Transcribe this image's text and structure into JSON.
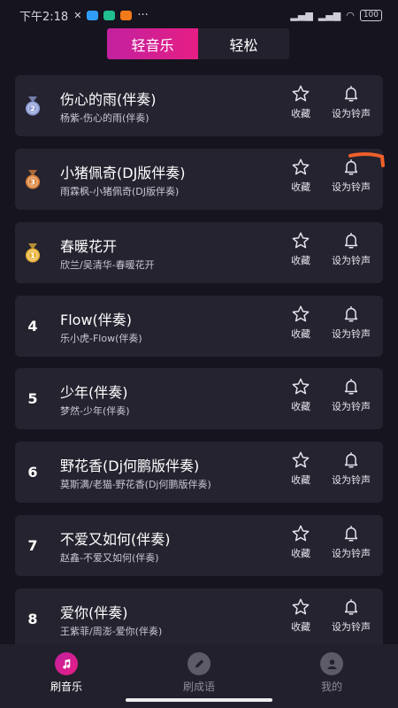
{
  "status_bar": {
    "time": "下午2:18",
    "battery": "100"
  },
  "tabs": [
    {
      "label": "轻音乐",
      "active": true
    },
    {
      "label": "轻松",
      "active": false
    }
  ],
  "songs": [
    {
      "rank": "2",
      "medal": "silver",
      "title": "伤心的雨(伴奏)",
      "artist": "杨紫-伤心的雨(伴奏)"
    },
    {
      "rank": "3",
      "medal": "bronze",
      "title": "小猪佩奇(DJ版伴奏)",
      "artist": "雨霖枫-小猪佩奇(DJ版伴奏)"
    },
    {
      "rank": "1",
      "medal": "gold",
      "title": "春暖花开",
      "artist": "欣兰/吴清华-春暖花开"
    },
    {
      "rank": "4",
      "medal": "",
      "title": "Flow(伴奏)",
      "artist": "乐小虎-Flow(伴奏)"
    },
    {
      "rank": "5",
      "medal": "",
      "title": "少年(伴奏)",
      "artist": "梦然-少年(伴奏)"
    },
    {
      "rank": "6",
      "medal": "",
      "title": "野花香(Dj何鹏版伴奏)",
      "artist": "莫斯满/老猫-野花香(Dj何鹏版伴奏)"
    },
    {
      "rank": "7",
      "medal": "",
      "title": "不爱又如何(伴奏)",
      "artist": "赵鑫-不爱又如何(伴奏)"
    },
    {
      "rank": "8",
      "medal": "",
      "title": "爱你(伴奏)",
      "artist": "王紫菲/周澎-爱你(伴奏)"
    }
  ],
  "actions": {
    "favorite_label": "收藏",
    "ringtone_label": "设为铃声"
  },
  "bottom_nav": [
    {
      "label": "刷音乐",
      "icon": "music-note-icon",
      "active": true
    },
    {
      "label": "刷成语",
      "icon": "pencil-icon",
      "active": false
    },
    {
      "label": "我的",
      "icon": "person-icon",
      "active": false
    }
  ],
  "colors": {
    "accent": "#e61e85",
    "background": "#16141f",
    "card": "#25232f",
    "medal_gold": "#e8b339",
    "medal_silver": "#8e9dd6",
    "medal_bronze": "#d9823a",
    "annotation_mark": "#f0602a"
  }
}
